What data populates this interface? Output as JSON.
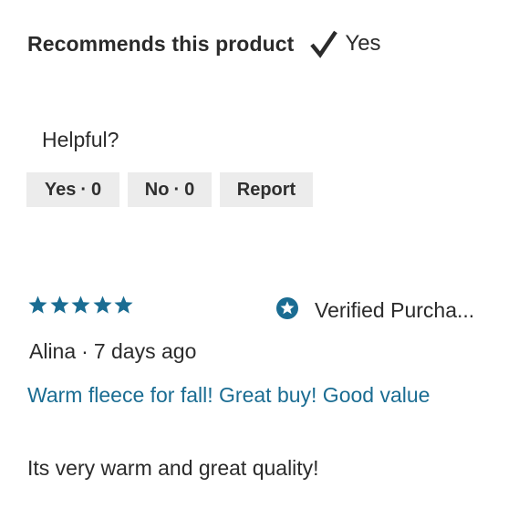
{
  "recommendation": {
    "label": "Recommends this product",
    "icon": "check-icon",
    "value": "Yes"
  },
  "helpful": {
    "question": "Helpful?",
    "yes_label": "Yes",
    "yes_count": "0",
    "no_label": "No",
    "no_count": "0",
    "report_label": "Report",
    "separator": "·"
  },
  "review": {
    "rating": 5,
    "rating_max": 5,
    "star_color": "#1a6c92",
    "verified_label": "Verified Purcha...",
    "verified_icon": "star-badge-icon",
    "author": "Alina",
    "separator": "·",
    "date": "7 days ago",
    "title": "Warm fleece for fall! Great buy! Good value",
    "title_color": "#1a6c92",
    "body": "Its very warm and great quality!"
  }
}
